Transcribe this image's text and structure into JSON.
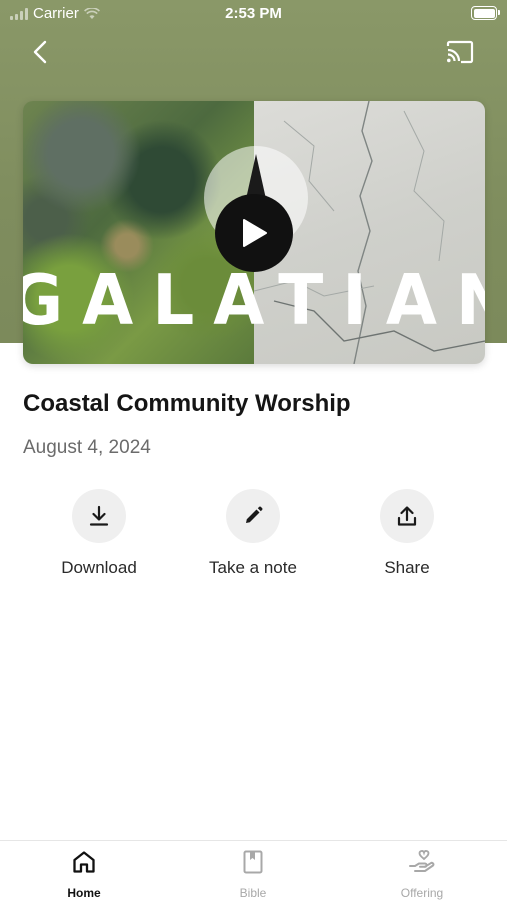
{
  "status_bar": {
    "carrier": "Carrier",
    "time": "2:53 PM"
  },
  "video": {
    "title_text": "GALATIANS",
    "play_icon": "play-icon"
  },
  "sermon": {
    "title": "Coastal Community Worship",
    "date": "August 4, 2024"
  },
  "actions": [
    {
      "label": "Download",
      "icon": "download-icon"
    },
    {
      "label": "Take a note",
      "icon": "pencil-icon"
    },
    {
      "label": "Share",
      "icon": "share-icon"
    }
  ],
  "tabs": [
    {
      "label": "Home",
      "icon": "home-icon",
      "active": true
    },
    {
      "label": "Bible",
      "icon": "bible-icon",
      "active": false
    },
    {
      "label": "Offering",
      "icon": "offering-icon",
      "active": false
    }
  ],
  "colors": {
    "header_bg": "#8a9868",
    "action_circle": "#efefef",
    "tab_active": "#111111",
    "tab_inactive": "#a8a8a8"
  }
}
